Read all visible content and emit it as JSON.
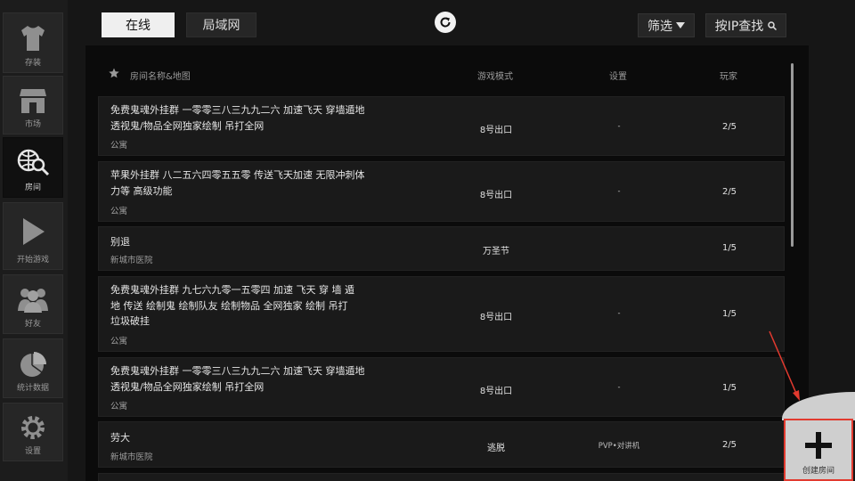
{
  "sidebar": {
    "items": [
      {
        "label": "存装",
        "icon": "shirt-icon"
      },
      {
        "label": "市场",
        "icon": "shop-icon"
      },
      {
        "label": "房间",
        "icon": "globe-search-icon"
      },
      {
        "label": "开始游戏",
        "icon": "play-icon"
      },
      {
        "label": "好友",
        "icon": "friends-icon"
      },
      {
        "label": "统计数据",
        "icon": "pie-chart-icon"
      },
      {
        "label": "设置",
        "icon": "gear-icon"
      }
    ]
  },
  "tabs": {
    "online": "在线",
    "lan": "局域网"
  },
  "toolbar": {
    "filter": "筛选",
    "ip_search": "按IP查找"
  },
  "table": {
    "headers": {
      "name": "房间名称&地图",
      "mode": "游戏模式",
      "settings": "设置",
      "players": "玩家"
    },
    "rows": [
      {
        "title": "免费鬼魂外挂群 一零零三八三九九二六 加速飞天 穿墙遁地 透视鬼/物品全网独家绘制 吊打全网",
        "map": "公寓",
        "mode": "8号出口",
        "settings": "-",
        "players": "2/5"
      },
      {
        "title": "苹果外挂群 八二五六四零五五零 传送飞天加速 无限冲刺体力等 高级功能",
        "map": "公寓",
        "mode": "8号出口",
        "settings": "-",
        "players": "2/5"
      },
      {
        "title": "别退",
        "map": "新城市医院",
        "mode": "万圣节",
        "settings": "",
        "players": "1/5"
      },
      {
        "title": "免费鬼魂外挂群 九七六九零一五零四 加速 飞天 穿 墙 遁地 传送 绘制鬼 绘制队友 绘制物品 全网独家 绘制 吊打垃圾破挂",
        "map": "公寓",
        "mode": "8号出口",
        "settings": "-",
        "players": "1/5"
      },
      {
        "title": "免费鬼魂外挂群 一零零三八三九九二六 加速飞天 穿墙遁地 透视鬼/物品全网独家绘制 吊打全网",
        "map": "公寓",
        "mode": "8号出口",
        "settings": "-",
        "players": "1/5"
      },
      {
        "title": "劳大",
        "map": "新城市医院",
        "mode": "逃脱",
        "settings": "PVP•对讲机",
        "players": "2/5"
      }
    ]
  },
  "create_room": {
    "label": "创建房间"
  },
  "colors": {
    "highlight_red": "#e23a2f",
    "active_tab_bg": "#efefef"
  }
}
